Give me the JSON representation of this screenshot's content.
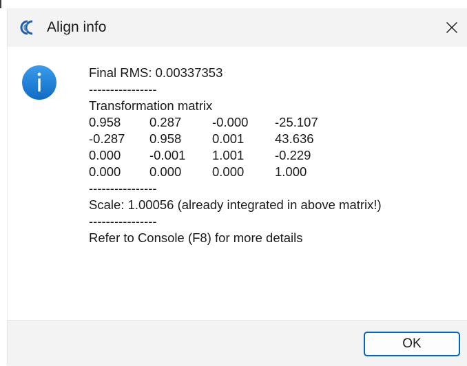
{
  "window": {
    "title": "Align info",
    "close_icon": "close-icon",
    "app_icon": "cloudcompare-logo-icon"
  },
  "message": {
    "icon": "info-icon",
    "final_rms": "Final RMS: 0.00337353",
    "separator": "----------------",
    "matrix_heading": "Transformation matrix",
    "matrix": [
      [
        "0.958",
        "0.287",
        "-0.000",
        "-25.107"
      ],
      [
        "-0.287",
        "0.958",
        "0.001",
        "43.636"
      ],
      [
        "0.000",
        "-0.001",
        "1.001",
        "-0.229"
      ],
      [
        "0.000",
        "0.000",
        "0.000",
        "1.000"
      ]
    ],
    "scale": "Scale: 1.00056 (already integrated in above matrix!)",
    "console_note": "Refer to Console (F8) for more details"
  },
  "footer": {
    "ok_label": "OK"
  },
  "colors": {
    "accent": "#0067c0",
    "info_icon": "#1a7fd6",
    "titlebar_bg": "#f3f3f3"
  }
}
